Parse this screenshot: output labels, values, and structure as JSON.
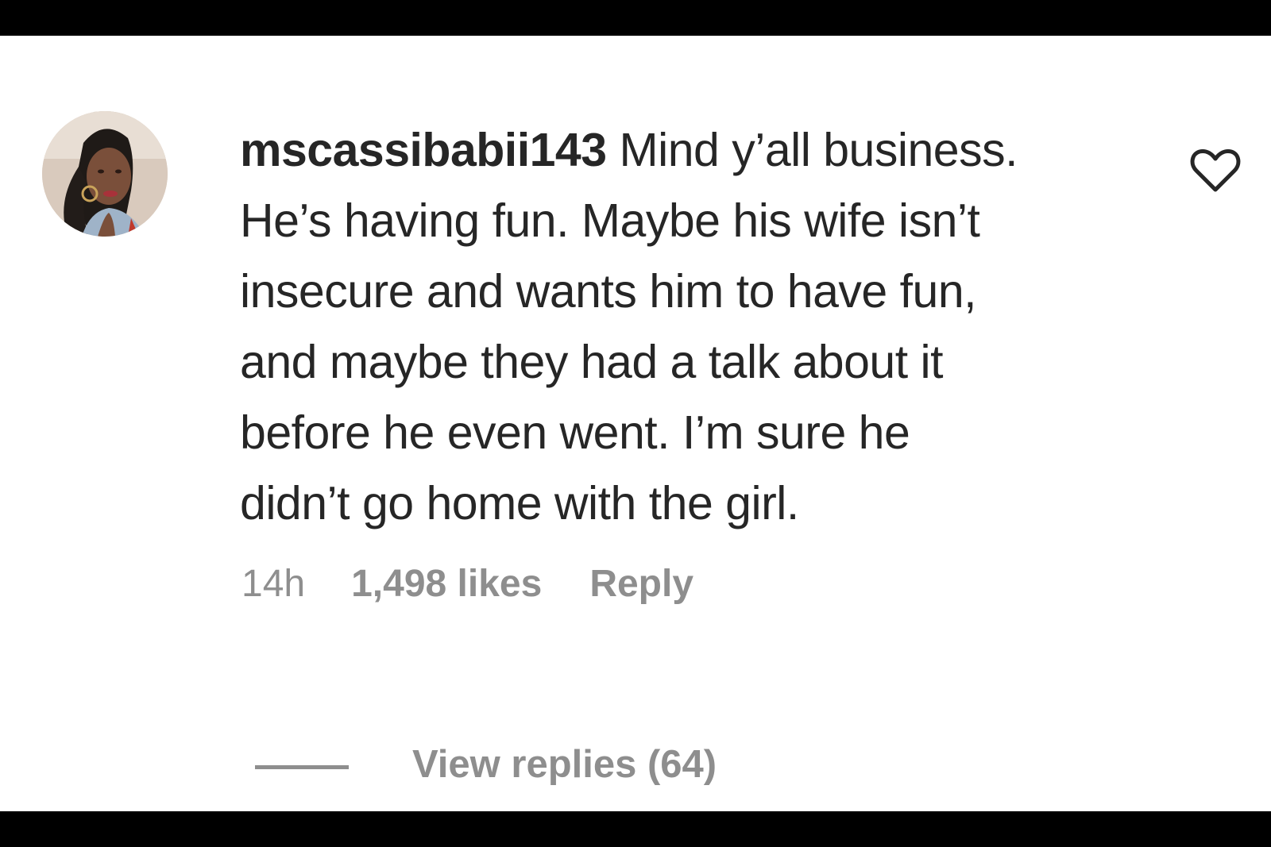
{
  "comment": {
    "username": "mscassibabii143",
    "text_lines": [
      " Mind y’all business.",
      "He’s having fun. Maybe his wife isn’t",
      "insecure and wants him to have fun,",
      "and maybe they had a talk about it",
      "before he even went. I’m sure he",
      "didn’t go home with the girl."
    ],
    "time": "14h",
    "likes": "1,498 likes",
    "reply_label": "Reply",
    "view_replies_label": "View replies (64)",
    "avatar_icon": "profile-photo",
    "like_icon": "heart-outline-icon"
  },
  "colors": {
    "text": "#262626",
    "meta": "#8e8e8e",
    "background": "#ffffff",
    "letterbox": "#000000"
  }
}
